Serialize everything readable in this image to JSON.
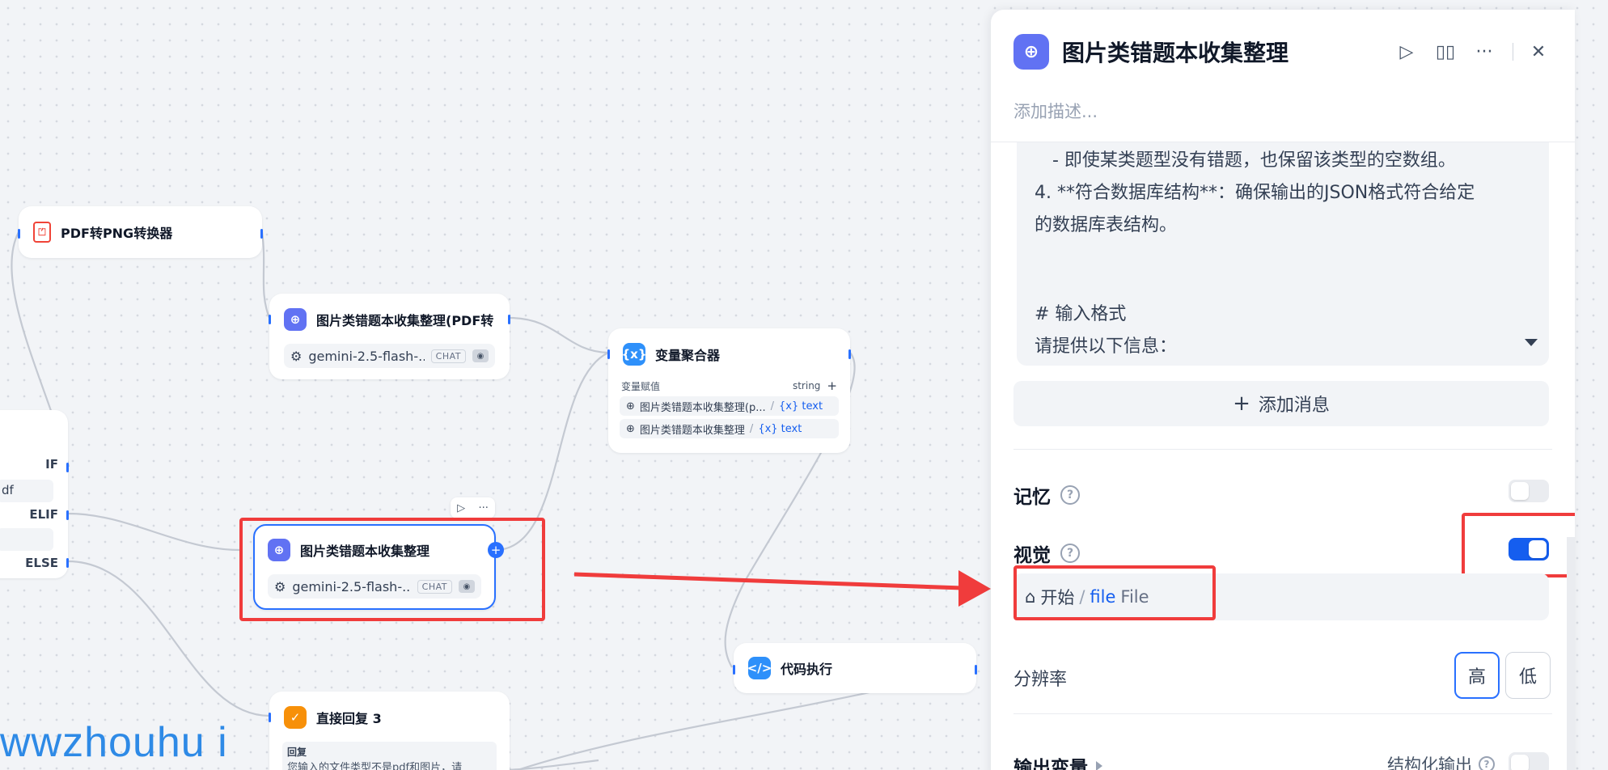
{
  "nodes": {
    "pdf2png": {
      "title": "PDF转PNG转换器"
    },
    "img_pdf": {
      "title": "图片类错题本收集整理(PDF转",
      "model": "gemini-2.5-flash-...",
      "badge": "CHAT"
    },
    "aggregator": {
      "title": "变量聚合器",
      "header_label": "变量赋值",
      "header_type": "string",
      "add_glyph": "+",
      "rows": [
        {
          "source": "图片类错题本收集整理(p...",
          "sep": "/",
          "var": "{x} text"
        },
        {
          "source": "图片类错题本收集整理",
          "sep": "/",
          "var": "{x} text"
        }
      ]
    },
    "ifelse": {
      "partial_text": "df",
      "if_label": "IF",
      "elif_label": "ELIF",
      "else_label": "ELSE"
    },
    "img_main": {
      "title": "图片类错题本收集整理",
      "model": "gemini-2.5-flash-...",
      "badge": "CHAT"
    },
    "code": {
      "title": "代码执行"
    },
    "reply": {
      "title": "直接回复 3",
      "sub_label": "回复",
      "text": "您输入的文件类型不是pdf和图片，请"
    }
  },
  "panel": {
    "title": "图片类错题本收集整理",
    "description_placeholder": "添加描述...",
    "prompt_lines": [
      "- 即使某类题型没有错题，也保留该类型的空数组。",
      "4. **符合数据库结构**：确保输出的JSON格式符合给定",
      "的数据库表结构。",
      "",
      "",
      "# 输入格式",
      "请提供以下信息："
    ],
    "add_message_label": "添加消息",
    "memory": {
      "label": "记忆",
      "enabled": false
    },
    "vision": {
      "label": "视觉",
      "enabled": true,
      "variable": {
        "node": "开始",
        "sep": "/",
        "name": "file",
        "type": "File"
      }
    },
    "resolution": {
      "label": "分辨率",
      "options": [
        "高",
        "低"
      ],
      "selected": "高"
    },
    "output": {
      "label": "输出变量",
      "structured_label": "结构化输出",
      "structured_enabled": false
    }
  },
  "watermark": "wwzhouhu i",
  "colors": {
    "accent": "#155eef",
    "highlight": "#f03c3c",
    "llm_icon": "#6172f3"
  },
  "icons": {
    "llm": "llm-brain-icon",
    "pdf": "pdf-file-icon",
    "aggregator": "variable-icon",
    "code": "code-icon",
    "reply": "reply-icon",
    "run": "play-icon",
    "docs": "book-icon",
    "more": "more-dots-icon",
    "close": "close-icon",
    "help": "help-circle-icon",
    "home": "home-icon"
  }
}
